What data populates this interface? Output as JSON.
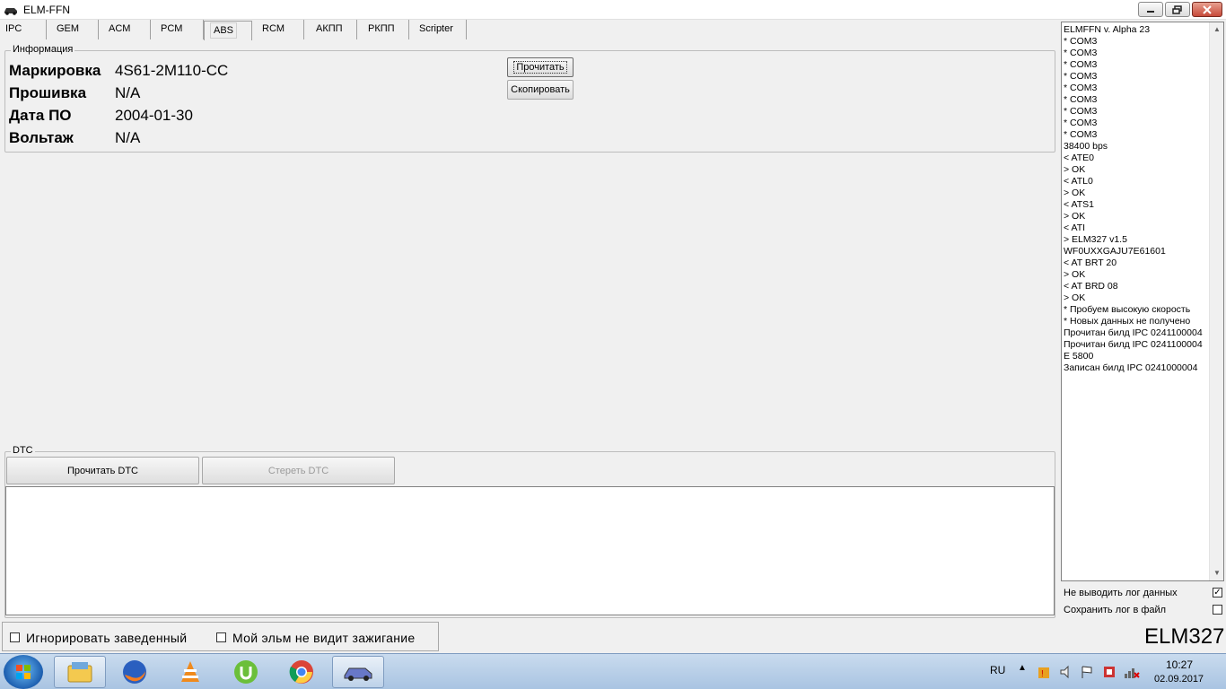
{
  "window": {
    "title": "ELM-FFN"
  },
  "tabs": [
    {
      "label": "IPC"
    },
    {
      "label": "GEM"
    },
    {
      "label": "ACM"
    },
    {
      "label": "PCM"
    },
    {
      "label": "ABS"
    },
    {
      "label": "RCM"
    },
    {
      "label": "АКПП"
    },
    {
      "label": "РКПП"
    },
    {
      "label": "Scripter"
    }
  ],
  "active_tab": "ABS",
  "info": {
    "legend": "Информация",
    "rows": [
      {
        "label": "Маркировка",
        "value": "4S61-2M110-CC"
      },
      {
        "label": "Прошивка",
        "value": "N/A"
      },
      {
        "label": "Дата ПО",
        "value": "2004-01-30"
      },
      {
        "label": "Вольтаж",
        "value": "N/A"
      }
    ],
    "read_button": "Прочитать",
    "copy_button": "Скопировать"
  },
  "dtc": {
    "legend": "DTC",
    "read_button": "Прочитать DTC",
    "clear_button": "Стереть DTC"
  },
  "log": {
    "lines": [
      "ELMFFN v. Alpha 23",
      "* COM3",
      "* COM3",
      "* COM3",
      "* COM3",
      "* COM3",
      "* COM3",
      "* COM3",
      "* COM3",
      "* COM3",
      "38400 bps",
      "< ATE0",
      "> OK",
      "< ATL0",
      "> OK",
      "< ATS1",
      "> OK",
      "< ATI",
      "> ELM327 v1.5",
      "WF0UXXGAJU7E61601",
      "< AT BRT 20",
      "> OK",
      "< AT BRD 08",
      "> OK",
      "* Пробуем высокую скорость",
      "* Новых данных не получено",
      "Прочитан билд IPC 0241100004",
      "Прочитан билд IPC 0241100004",
      "E 5800",
      "Записан билд IPC 0241000004"
    ],
    "no_log_label": "Не выводить лог данных",
    "no_log_checked": true,
    "save_log_label": "Сохранить лог в файл",
    "save_log_checked": false
  },
  "options": {
    "ignore_running": "Игнорировать заведенный",
    "no_ignition": "Мой эльм не видит зажигание"
  },
  "adapter": "ELM327",
  "taskbar": {
    "lang": "RU",
    "time": "10:27",
    "date": "02.09.2017",
    "apps": [
      "explorer-icon",
      "firefox-icon",
      "vlc-icon",
      "utorrent-icon",
      "chrome-icon",
      "elmffn-car-icon"
    ]
  }
}
